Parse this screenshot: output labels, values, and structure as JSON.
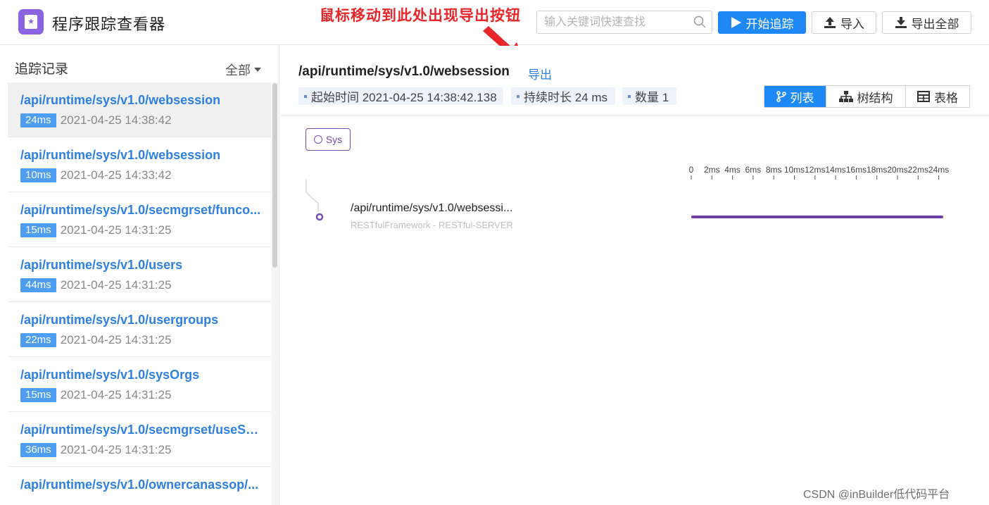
{
  "app": {
    "title": "程序跟踪查看器"
  },
  "annotation": {
    "text": "鼠标移动到此处出现导出按钮"
  },
  "search": {
    "placeholder": "输入关键词快速查找"
  },
  "toolbar": {
    "start_label": "开始追踪",
    "import_label": "导入",
    "export_all_label": "导出全部"
  },
  "sidebar": {
    "title": "追踪记录",
    "filter_label": "全部",
    "items": [
      {
        "path": "/api/runtime/sys/v1.0/websession",
        "duration": "24ms",
        "time": "2021-04-25 14:38:42"
      },
      {
        "path": "/api/runtime/sys/v1.0/websession",
        "duration": "10ms",
        "time": "2021-04-25 14:33:42"
      },
      {
        "path": "/api/runtime/sys/v1.0/secmgrset/funco...",
        "duration": "15ms",
        "time": "2021-04-25 14:31:25"
      },
      {
        "path": "/api/runtime/sys/v1.0/users",
        "duration": "44ms",
        "time": "2021-04-25 14:31:25"
      },
      {
        "path": "/api/runtime/sys/v1.0/usergroups",
        "duration": "22ms",
        "time": "2021-04-25 14:31:25"
      },
      {
        "path": "/api/runtime/sys/v1.0/sysOrgs",
        "duration": "15ms",
        "time": "2021-04-25 14:31:25"
      },
      {
        "path": "/api/runtime/sys/v1.0/secmgrset/useSe...",
        "duration": "36ms",
        "time": "2021-04-25 14:31:25"
      },
      {
        "path": "/api/runtime/sys/v1.0/ownercanassop/...",
        "duration": "",
        "time": ""
      }
    ]
  },
  "detail": {
    "title": "/api/runtime/sys/v1.0/websession",
    "export_label": "导出",
    "start_time": "起始时间 2021-04-25 14:38:42.138",
    "duration": "持续时长 24 ms",
    "count": "数量 1",
    "views": {
      "list": "列表",
      "tree": "树结构",
      "table": "表格"
    },
    "service_chip": "Sys",
    "timeline_ticks": [
      "0",
      "2ms",
      "4ms",
      "6ms",
      "8ms",
      "10ms",
      "12ms",
      "14ms",
      "16ms",
      "18ms",
      "20ms",
      "22ms",
      "24ms"
    ],
    "span": {
      "name": "/api/runtime/sys/v1.0/websessi...",
      "subtitle": "RESTfulFramework - RESTful-SERVER",
      "start_ms": 0,
      "duration_ms": 24,
      "color": "#6d3fa5"
    }
  },
  "watermark": "CSDN @inBuilder低代码平台",
  "colors": {
    "primary": "#1e88f5",
    "accent": "#8a63e0",
    "annotation": "#e8262a",
    "link": "#2d7fe0"
  }
}
